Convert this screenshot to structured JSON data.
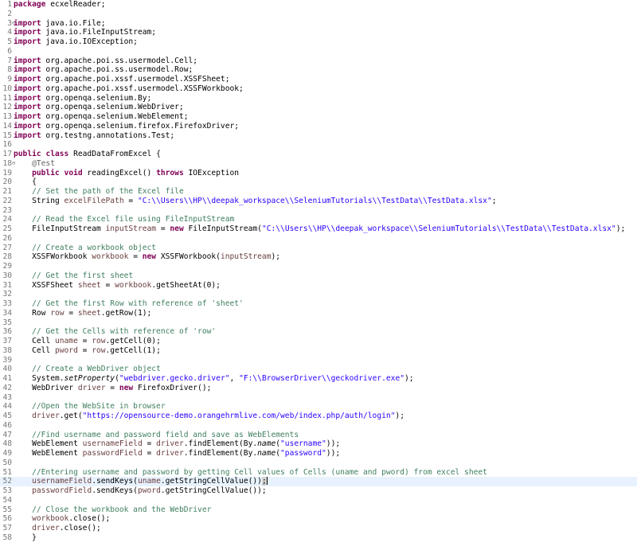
{
  "editor": {
    "current_line": 52,
    "colors": {
      "keyword": "#7f0055",
      "string": "#2a00ff",
      "comment": "#3f7f5f",
      "local_variable": "#6a3e3e",
      "annotation": "#646464",
      "line_number": "#787878",
      "current_line_bg": "#e8f2fe"
    },
    "lines": [
      {
        "n": "1",
        "fold": false,
        "tokens": [
          {
            "t": "kw",
            "v": "package"
          },
          {
            "t": "pl",
            "v": " ecxelReader;"
          }
        ]
      },
      {
        "n": "2",
        "fold": false,
        "tokens": []
      },
      {
        "n": "3",
        "fold": true,
        "tokens": [
          {
            "t": "kw",
            "v": "import"
          },
          {
            "t": "pl",
            "v": " java.io.File;"
          }
        ]
      },
      {
        "n": "4",
        "fold": false,
        "tokens": [
          {
            "t": "kw",
            "v": "import"
          },
          {
            "t": "pl",
            "v": " java.io.FileInputStream;"
          }
        ]
      },
      {
        "n": "5",
        "fold": false,
        "tokens": [
          {
            "t": "kw",
            "v": "import"
          },
          {
            "t": "pl",
            "v": " java.io.IOException;"
          }
        ]
      },
      {
        "n": "6",
        "fold": false,
        "tokens": []
      },
      {
        "n": "7",
        "fold": false,
        "tokens": [
          {
            "t": "kw",
            "v": "import"
          },
          {
            "t": "pl",
            "v": " org.apache.poi.ss.usermodel.Cell;"
          }
        ]
      },
      {
        "n": "8",
        "fold": false,
        "tokens": [
          {
            "t": "kw",
            "v": "import"
          },
          {
            "t": "pl",
            "v": " org.apache.poi.ss.usermodel.Row;"
          }
        ]
      },
      {
        "n": "9",
        "fold": false,
        "tokens": [
          {
            "t": "kw",
            "v": "import"
          },
          {
            "t": "pl",
            "v": " org.apache.poi.xssf.usermodel.XSSFSheet;"
          }
        ]
      },
      {
        "n": "10",
        "fold": false,
        "tokens": [
          {
            "t": "kw",
            "v": "import"
          },
          {
            "t": "pl",
            "v": " org.apache.poi.xssf.usermodel.XSSFWorkbook;"
          }
        ]
      },
      {
        "n": "11",
        "fold": false,
        "tokens": [
          {
            "t": "kw",
            "v": "import"
          },
          {
            "t": "pl",
            "v": " org.openqa.selenium.By;"
          }
        ]
      },
      {
        "n": "12",
        "fold": false,
        "tokens": [
          {
            "t": "kw",
            "v": "import"
          },
          {
            "t": "pl",
            "v": " org.openqa.selenium.WebDriver;"
          }
        ]
      },
      {
        "n": "13",
        "fold": false,
        "tokens": [
          {
            "t": "kw",
            "v": "import"
          },
          {
            "t": "pl",
            "v": " org.openqa.selenium.WebElement;"
          }
        ]
      },
      {
        "n": "14",
        "fold": false,
        "tokens": [
          {
            "t": "kw",
            "v": "import"
          },
          {
            "t": "pl",
            "v": " org.openqa.selenium.firefox.FirefoxDriver;"
          }
        ]
      },
      {
        "n": "15",
        "fold": false,
        "tokens": [
          {
            "t": "kw",
            "v": "import"
          },
          {
            "t": "pl",
            "v": " org.testng.annotations.Test;"
          }
        ]
      },
      {
        "n": "16",
        "fold": false,
        "tokens": []
      },
      {
        "n": "17",
        "fold": false,
        "tokens": [
          {
            "t": "kw",
            "v": "public"
          },
          {
            "t": "pl",
            "v": " "
          },
          {
            "t": "kw",
            "v": "class"
          },
          {
            "t": "pl",
            "v": " ReadDataFromExcel {"
          }
        ]
      },
      {
        "n": "18",
        "fold": true,
        "tokens": [
          {
            "t": "pl",
            "v": "    "
          },
          {
            "t": "ann",
            "v": "@Test"
          }
        ]
      },
      {
        "n": "19",
        "fold": false,
        "tokens": [
          {
            "t": "pl",
            "v": "    "
          },
          {
            "t": "kw",
            "v": "public"
          },
          {
            "t": "pl",
            "v": " "
          },
          {
            "t": "kw",
            "v": "void"
          },
          {
            "t": "pl",
            "v": " readingExcel() "
          },
          {
            "t": "kw",
            "v": "throws"
          },
          {
            "t": "pl",
            "v": " IOException"
          }
        ]
      },
      {
        "n": "20",
        "fold": false,
        "tokens": [
          {
            "t": "pl",
            "v": "    {"
          }
        ]
      },
      {
        "n": "21",
        "fold": false,
        "tokens": [
          {
            "t": "pl",
            "v": "    "
          },
          {
            "t": "com",
            "v": "// Set the path of the Excel file"
          }
        ]
      },
      {
        "n": "22",
        "fold": false,
        "tokens": [
          {
            "t": "pl",
            "v": "    String "
          },
          {
            "t": "var",
            "v": "excelFilePath"
          },
          {
            "t": "pl",
            "v": " = "
          },
          {
            "t": "str",
            "v": "\"C:\\\\Users\\\\HP\\\\deepak_workspace\\\\SeleniumTutorials\\\\TestData\\\\TestData.xlsx\""
          },
          {
            "t": "pl",
            "v": ";"
          }
        ]
      },
      {
        "n": "23",
        "fold": false,
        "tokens": []
      },
      {
        "n": "24",
        "fold": false,
        "tokens": [
          {
            "t": "pl",
            "v": "    "
          },
          {
            "t": "com",
            "v": "// Read the Excel file using FileInputStream"
          }
        ]
      },
      {
        "n": "25",
        "fold": false,
        "tokens": [
          {
            "t": "pl",
            "v": "    FileInputStream "
          },
          {
            "t": "var",
            "v": "inputStream"
          },
          {
            "t": "pl",
            "v": " = "
          },
          {
            "t": "kw",
            "v": "new"
          },
          {
            "t": "pl",
            "v": " FileInputStream("
          },
          {
            "t": "str",
            "v": "\"C:\\\\Users\\\\HP\\\\deepak_workspace\\\\SeleniumTutorials\\\\TestData\\\\TestData.xlsx\""
          },
          {
            "t": "pl",
            "v": ");"
          }
        ]
      },
      {
        "n": "26",
        "fold": false,
        "tokens": []
      },
      {
        "n": "27",
        "fold": false,
        "tokens": [
          {
            "t": "pl",
            "v": "    "
          },
          {
            "t": "com",
            "v": "// Create a workbook object"
          }
        ]
      },
      {
        "n": "28",
        "fold": false,
        "tokens": [
          {
            "t": "pl",
            "v": "    XSSFWorkbook "
          },
          {
            "t": "var",
            "v": "workbook"
          },
          {
            "t": "pl",
            "v": " = "
          },
          {
            "t": "kw",
            "v": "new"
          },
          {
            "t": "pl",
            "v": " XSSFWorkbook("
          },
          {
            "t": "var",
            "v": "inputStream"
          },
          {
            "t": "pl",
            "v": ");"
          }
        ]
      },
      {
        "n": "29",
        "fold": false,
        "tokens": []
      },
      {
        "n": "30",
        "fold": false,
        "tokens": [
          {
            "t": "pl",
            "v": "    "
          },
          {
            "t": "com",
            "v": "// Get the first sheet"
          }
        ]
      },
      {
        "n": "31",
        "fold": false,
        "tokens": [
          {
            "t": "pl",
            "v": "    XSSFSheet "
          },
          {
            "t": "var",
            "v": "sheet"
          },
          {
            "t": "pl",
            "v": " = "
          },
          {
            "t": "var",
            "v": "workbook"
          },
          {
            "t": "pl",
            "v": ".getSheetAt(0);"
          }
        ]
      },
      {
        "n": "32",
        "fold": false,
        "tokens": []
      },
      {
        "n": "33",
        "fold": false,
        "tokens": [
          {
            "t": "pl",
            "v": "    "
          },
          {
            "t": "com",
            "v": "// Get the first Row with reference of 'sheet'"
          }
        ]
      },
      {
        "n": "34",
        "fold": false,
        "tokens": [
          {
            "t": "pl",
            "v": "    Row "
          },
          {
            "t": "var",
            "v": "row"
          },
          {
            "t": "pl",
            "v": " = "
          },
          {
            "t": "var",
            "v": "sheet"
          },
          {
            "t": "pl",
            "v": ".getRow(1);"
          }
        ]
      },
      {
        "n": "35",
        "fold": false,
        "tokens": []
      },
      {
        "n": "36",
        "fold": false,
        "tokens": [
          {
            "t": "pl",
            "v": "    "
          },
          {
            "t": "com",
            "v": "// Get the Cells with reference of 'row'"
          }
        ]
      },
      {
        "n": "37",
        "fold": false,
        "tokens": [
          {
            "t": "pl",
            "v": "    Cell "
          },
          {
            "t": "var",
            "v": "uname"
          },
          {
            "t": "pl",
            "v": " = "
          },
          {
            "t": "var",
            "v": "row"
          },
          {
            "t": "pl",
            "v": ".getCell(0);"
          }
        ]
      },
      {
        "n": "38",
        "fold": false,
        "tokens": [
          {
            "t": "pl",
            "v": "    Cell "
          },
          {
            "t": "var",
            "v": "pword"
          },
          {
            "t": "pl",
            "v": " = "
          },
          {
            "t": "var",
            "v": "row"
          },
          {
            "t": "pl",
            "v": ".getCell(1);"
          }
        ]
      },
      {
        "n": "39",
        "fold": false,
        "tokens": []
      },
      {
        "n": "40",
        "fold": false,
        "tokens": [
          {
            "t": "pl",
            "v": "    "
          },
          {
            "t": "com",
            "v": "// Create a WebDriver object"
          }
        ]
      },
      {
        "n": "41",
        "fold": false,
        "tokens": [
          {
            "t": "pl",
            "v": "    System."
          },
          {
            "t": "it",
            "v": "setProperty"
          },
          {
            "t": "pl",
            "v": "("
          },
          {
            "t": "str",
            "v": "\"webdriver.gecko.driver\""
          },
          {
            "t": "pl",
            "v": ", "
          },
          {
            "t": "str",
            "v": "\"F:\\\\BrowserDriver\\\\geckodriver.exe\""
          },
          {
            "t": "pl",
            "v": ");"
          }
        ]
      },
      {
        "n": "42",
        "fold": false,
        "tokens": [
          {
            "t": "pl",
            "v": "    WebDriver "
          },
          {
            "t": "var",
            "v": "driver"
          },
          {
            "t": "pl",
            "v": " = "
          },
          {
            "t": "kw",
            "v": "new"
          },
          {
            "t": "pl",
            "v": " FirefoxDriver();"
          }
        ]
      },
      {
        "n": "43",
        "fold": false,
        "tokens": []
      },
      {
        "n": "44",
        "fold": false,
        "tokens": [
          {
            "t": "pl",
            "v": "    "
          },
          {
            "t": "com",
            "v": "//Open the WebSite in browser"
          }
        ]
      },
      {
        "n": "45",
        "fold": false,
        "tokens": [
          {
            "t": "pl",
            "v": "    "
          },
          {
            "t": "var",
            "v": "driver"
          },
          {
            "t": "pl",
            "v": ".get("
          },
          {
            "t": "str",
            "v": "\"https://opensource-demo.orangehrmlive.com/web/index.php/auth/login\""
          },
          {
            "t": "pl",
            "v": ");"
          }
        ]
      },
      {
        "n": "46",
        "fold": false,
        "tokens": []
      },
      {
        "n": "47",
        "fold": false,
        "tokens": [
          {
            "t": "pl",
            "v": "    "
          },
          {
            "t": "com",
            "v": "//Find username and password field and save as WebElements"
          }
        ]
      },
      {
        "n": "48",
        "fold": false,
        "tokens": [
          {
            "t": "pl",
            "v": "    WebElement "
          },
          {
            "t": "var",
            "v": "usernameField"
          },
          {
            "t": "pl",
            "v": " = "
          },
          {
            "t": "var",
            "v": "driver"
          },
          {
            "t": "pl",
            "v": ".findElement(By."
          },
          {
            "t": "it",
            "v": "name"
          },
          {
            "t": "pl",
            "v": "("
          },
          {
            "t": "str",
            "v": "\"username\""
          },
          {
            "t": "pl",
            "v": "));"
          }
        ]
      },
      {
        "n": "49",
        "fold": false,
        "tokens": [
          {
            "t": "pl",
            "v": "    WebElement "
          },
          {
            "t": "var",
            "v": "passwordField"
          },
          {
            "t": "pl",
            "v": " = "
          },
          {
            "t": "var",
            "v": "driver"
          },
          {
            "t": "pl",
            "v": ".findElement(By."
          },
          {
            "t": "it",
            "v": "name"
          },
          {
            "t": "pl",
            "v": "("
          },
          {
            "t": "str",
            "v": "\"password\""
          },
          {
            "t": "pl",
            "v": "));"
          }
        ]
      },
      {
        "n": "50",
        "fold": false,
        "tokens": []
      },
      {
        "n": "51",
        "fold": false,
        "tokens": [
          {
            "t": "pl",
            "v": "    "
          },
          {
            "t": "com",
            "v": "//Entering username and password by getting Cell values of Cells (uname and pword) from excel sheet"
          }
        ]
      },
      {
        "n": "52",
        "fold": false,
        "tokens": [
          {
            "t": "pl",
            "v": "    "
          },
          {
            "t": "var",
            "v": "usernameField"
          },
          {
            "t": "pl",
            "v": ".sendKeys("
          },
          {
            "t": "var",
            "v": "uname"
          },
          {
            "t": "pl",
            "v": ".getStringCellValue())"
          },
          {
            "t": "hl",
            "v": ";"
          },
          {
            "t": "caret",
            "v": ""
          }
        ]
      },
      {
        "n": "53",
        "fold": false,
        "tokens": [
          {
            "t": "pl",
            "v": "    "
          },
          {
            "t": "var",
            "v": "passwordField"
          },
          {
            "t": "pl",
            "v": ".sendKeys("
          },
          {
            "t": "var",
            "v": "pword"
          },
          {
            "t": "pl",
            "v": ".getStringCellValue());"
          }
        ]
      },
      {
        "n": "54",
        "fold": false,
        "tokens": []
      },
      {
        "n": "55",
        "fold": false,
        "tokens": [
          {
            "t": "pl",
            "v": "    "
          },
          {
            "t": "com",
            "v": "// Close the workbook and the WebDriver"
          }
        ]
      },
      {
        "n": "56",
        "fold": false,
        "tokens": [
          {
            "t": "pl",
            "v": "    "
          },
          {
            "t": "var",
            "v": "workbook"
          },
          {
            "t": "pl",
            "v": ".close();"
          }
        ]
      },
      {
        "n": "57",
        "fold": false,
        "tokens": [
          {
            "t": "pl",
            "v": "    "
          },
          {
            "t": "var",
            "v": "driver"
          },
          {
            "t": "pl",
            "v": ".close();"
          }
        ]
      },
      {
        "n": "58",
        "fold": false,
        "tokens": [
          {
            "t": "pl",
            "v": "    }"
          }
        ]
      }
    ]
  }
}
